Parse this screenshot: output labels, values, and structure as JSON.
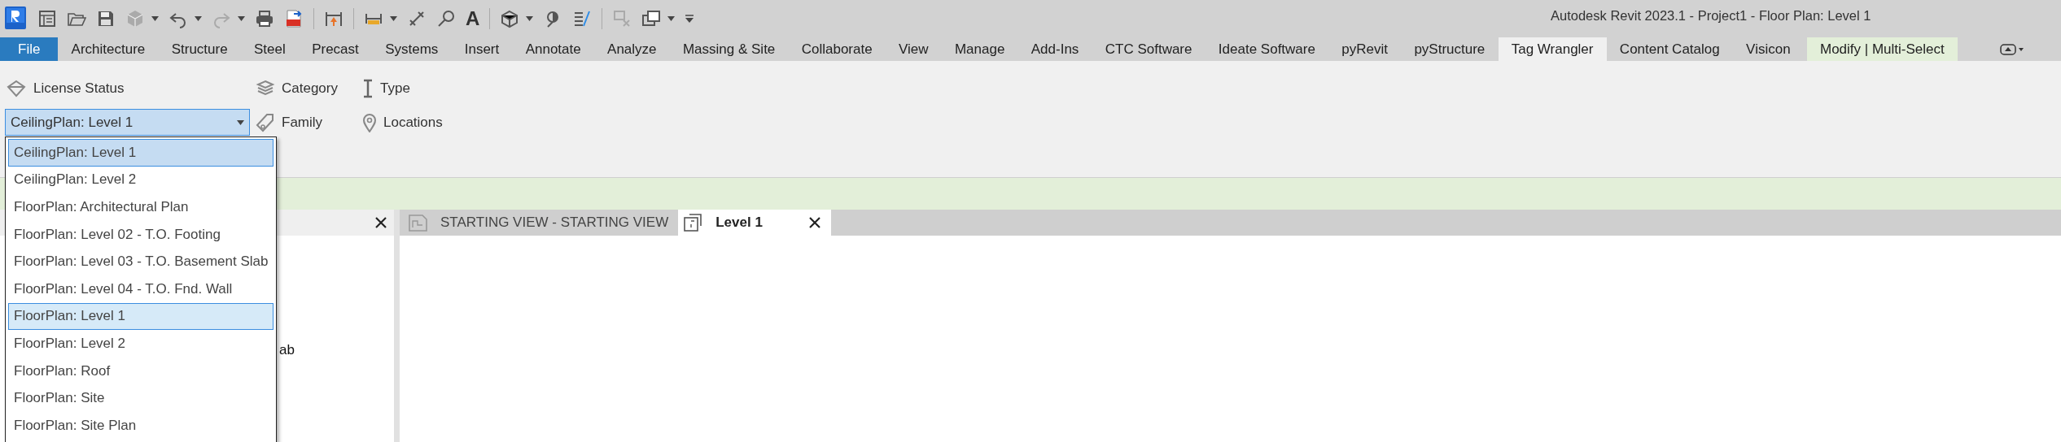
{
  "window": {
    "title": "Autodesk Revit 2023.1 - Project1 - Floor Plan: Level 1"
  },
  "quick_access": {
    "text_tool_label": "A"
  },
  "ribbon_tabs": [
    {
      "label": "File",
      "kind": "file",
      "selected": false
    },
    {
      "label": "Architecture",
      "kind": "tab",
      "selected": false
    },
    {
      "label": "Structure",
      "kind": "tab",
      "selected": false
    },
    {
      "label": "Steel",
      "kind": "tab",
      "selected": false
    },
    {
      "label": "Precast",
      "kind": "tab",
      "selected": false
    },
    {
      "label": "Systems",
      "kind": "tab",
      "selected": false
    },
    {
      "label": "Insert",
      "kind": "tab",
      "selected": false
    },
    {
      "label": "Annotate",
      "kind": "tab",
      "selected": false
    },
    {
      "label": "Analyze",
      "kind": "tab",
      "selected": false
    },
    {
      "label": "Massing & Site",
      "kind": "tab",
      "selected": false
    },
    {
      "label": "Collaborate",
      "kind": "tab",
      "selected": false
    },
    {
      "label": "View",
      "kind": "tab",
      "selected": false
    },
    {
      "label": "Manage",
      "kind": "tab",
      "selected": false
    },
    {
      "label": "Add-Ins",
      "kind": "tab",
      "selected": false
    },
    {
      "label": "CTC Software",
      "kind": "tab",
      "selected": false
    },
    {
      "label": "Ideate Software",
      "kind": "tab",
      "selected": false
    },
    {
      "label": "pyRevit",
      "kind": "tab",
      "selected": false
    },
    {
      "label": "pyStructure",
      "kind": "tab",
      "selected": false
    },
    {
      "label": "Tag Wrangler",
      "kind": "tab",
      "selected": true
    },
    {
      "label": "Content Catalog",
      "kind": "tab",
      "selected": false
    },
    {
      "label": "Visicon",
      "kind": "tab",
      "selected": false
    },
    {
      "label": "Modify | Multi-Select",
      "kind": "contextual",
      "selected": false
    }
  ],
  "ribbon_panel": {
    "license_button": "License Status",
    "view_combo": {
      "value": "CeilingPlan: Level 1"
    },
    "buttons": [
      {
        "label": "Category",
        "kind": "category"
      },
      {
        "label": "Type",
        "kind": "type"
      },
      {
        "label": "Family",
        "kind": "family"
      },
      {
        "label": "Locations",
        "kind": "locations"
      }
    ]
  },
  "view_dropdown": [
    {
      "label": "CeilingPlan: Level 1",
      "selected": true,
      "highlighted": false
    },
    {
      "label": "CeilingPlan: Level 2",
      "selected": false,
      "highlighted": false
    },
    {
      "label": "FloorPlan: Architectural Plan",
      "selected": false,
      "highlighted": false
    },
    {
      "label": "FloorPlan: Level 02 - T.O. Footing",
      "selected": false,
      "highlighted": false
    },
    {
      "label": "FloorPlan: Level 03 - T.O. Basement Slab",
      "selected": false,
      "highlighted": false
    },
    {
      "label": "FloorPlan: Level 04 - T.O. Fnd. Wall",
      "selected": false,
      "highlighted": false
    },
    {
      "label": "FloorPlan: Level 1",
      "selected": false,
      "highlighted": true
    },
    {
      "label": "FloorPlan: Level 2",
      "selected": false,
      "highlighted": false
    },
    {
      "label": "FloorPlan: Roof",
      "selected": false,
      "highlighted": false
    },
    {
      "label": "FloorPlan: Site",
      "selected": false,
      "highlighted": false
    },
    {
      "label": "FloorPlan: Site Plan",
      "selected": false,
      "highlighted": false
    }
  ],
  "project_browser": {
    "visible_text": "ab"
  },
  "view_tabs": [
    {
      "label": "STARTING VIEW - STARTING VIEW",
      "selected": false
    },
    {
      "label": "Level 1",
      "selected": true
    }
  ]
}
